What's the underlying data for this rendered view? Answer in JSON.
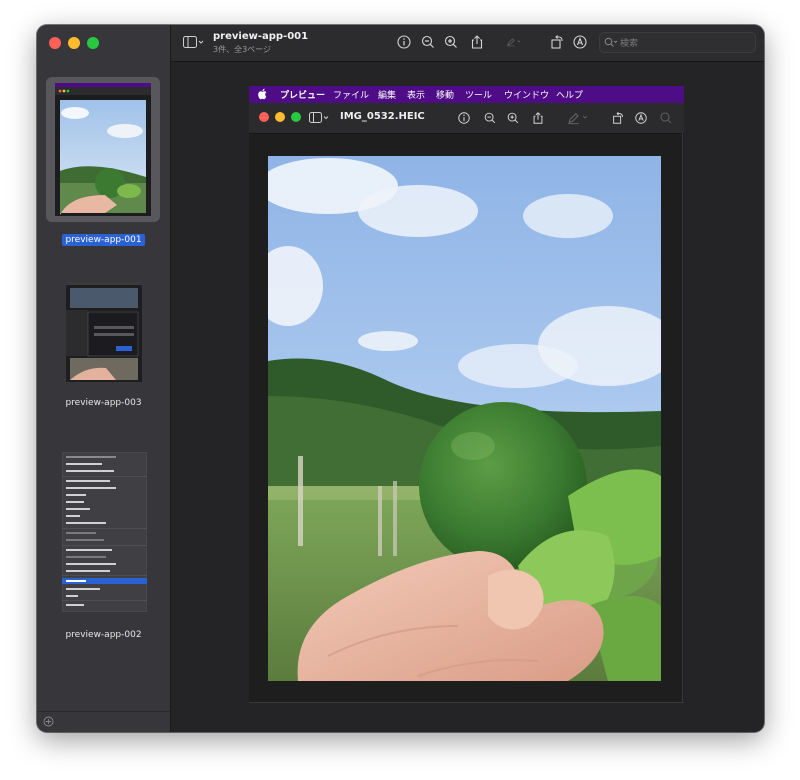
{
  "window": {
    "title": "preview-app-001",
    "subtitle": "3件、全3ページ"
  },
  "toolbar": {
    "search_placeholder": "検索",
    "icons": [
      "sidebar-icon",
      "chevron-down-icon",
      "info-icon",
      "zoom-out-icon",
      "zoom-in-icon",
      "share-icon",
      "markup-pen-icon",
      "rotate-icon",
      "annotate-icon",
      "search-icon"
    ]
  },
  "sidebar": {
    "items": [
      {
        "label": "preview-app-001",
        "selected": true
      },
      {
        "label": "preview-app-003",
        "selected": false
      },
      {
        "label": "preview-app-002",
        "selected": false
      }
    ]
  },
  "inner": {
    "menubar": {
      "items": [
        "プレビュー",
        "ファイル",
        "編集",
        "表示",
        "移動",
        "ツール",
        "ウインドウ",
        "ヘルプ"
      ]
    },
    "title": "IMG_0532.HEIC"
  },
  "colors": {
    "menubar": "#4e0d86",
    "selection": "#2a62d4",
    "window_bg": "#242426",
    "sidebar_bg": "#37363a"
  }
}
